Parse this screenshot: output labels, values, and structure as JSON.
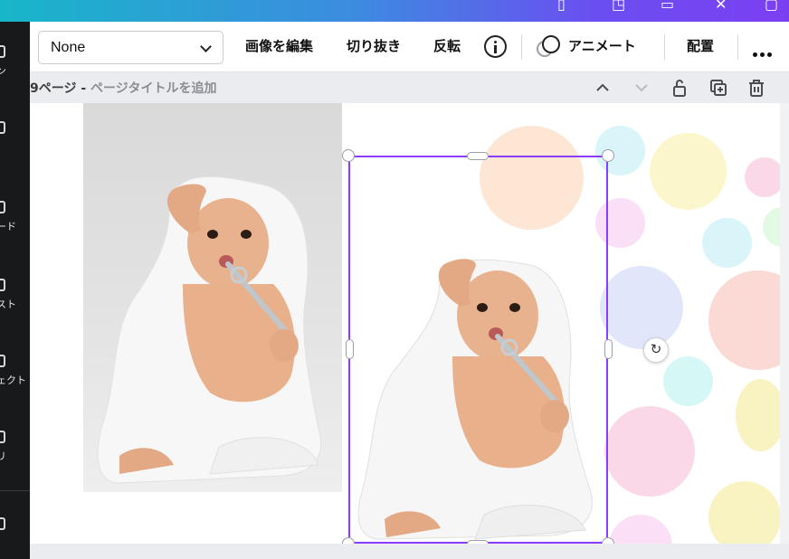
{
  "appbar": {
    "icons": [
      "device-icon",
      "user-icon",
      "chart-icon",
      "close-icon",
      "window-icon"
    ]
  },
  "leftrail": {
    "items": [
      {
        "label": "ン"
      },
      {
        "label": ""
      },
      {
        "label": "ード"
      },
      {
        "label": "スト"
      },
      {
        "label": "ェクト"
      },
      {
        "label": "リ"
      },
      {
        "label": ""
      }
    ]
  },
  "toolbar": {
    "select_value": "None",
    "edit_image": "画像を編集",
    "crop": "切り抜き",
    "flip": "反転",
    "animate": "アニメート",
    "position": "配置"
  },
  "page": {
    "number_label": "9ページ - ",
    "title_placeholder": "ページタイトルを追加"
  },
  "colors": {
    "accent": "#8b3dff",
    "dots": [
      "#fbd3b0",
      "#b9ecf5",
      "#f7efa0",
      "#f8b8d6",
      "#c9d2f7",
      "#f8b9b0",
      "#b2f0ef",
      "#f7c4ef",
      "#c8f5c8",
      "#f4e98f"
    ]
  },
  "images": {
    "left": "baby-in-towel-photo-original",
    "right": "baby-in-towel-photo-background-removed"
  }
}
